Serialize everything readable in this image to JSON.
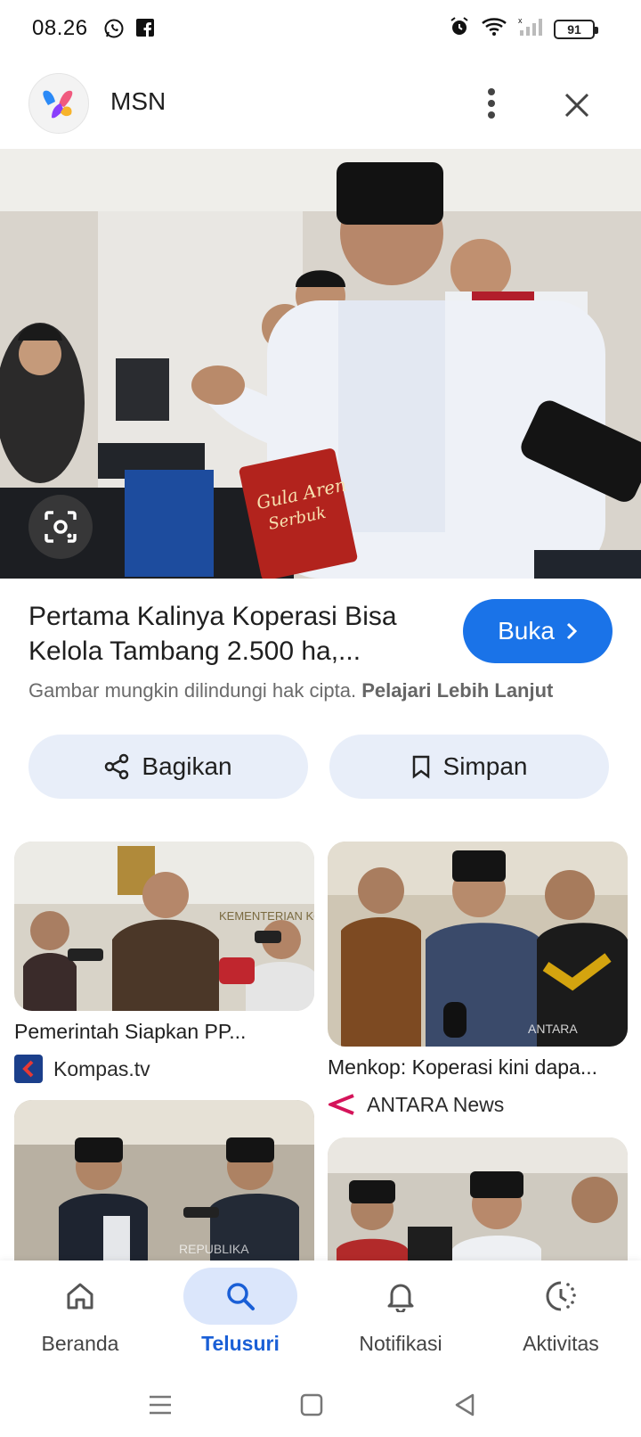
{
  "status_bar": {
    "time": "08.26",
    "battery": "91",
    "icons": [
      "whatsapp-icon",
      "facebook-icon",
      "alarm-icon",
      "wifi-icon",
      "cell-signal-icon"
    ]
  },
  "header": {
    "app_title": "MSN",
    "logo_icon": "msn-logo-icon",
    "more_icon": "more-vert-icon",
    "close_icon": "close-icon"
  },
  "hero": {
    "lens_icon": "google-lens-icon",
    "title": "Pertama Kalinya Koperasi Bisa Kelola Tambang 2.500 ha,...",
    "open_label": "Buka",
    "copyright_text": "Gambar mungkin dilindungi hak cipta.",
    "learn_more": "Pelajari Lebih Lanjut"
  },
  "actions": {
    "share_label": "Bagikan",
    "save_label": "Simpan"
  },
  "related": [
    {
      "title": "Pemerintah Siapkan PP...",
      "source": "Kompas.tv",
      "source_color": "#1b3f8b"
    },
    {
      "title": "Menkop: Koperasi kini dapa...",
      "source": "ANTARA News",
      "source_color": "#d4145a"
    },
    {
      "title": "",
      "source": ""
    },
    {
      "title": "",
      "source": ""
    }
  ],
  "bottom_nav": [
    {
      "label": "Beranda",
      "icon": "home-icon",
      "active": false
    },
    {
      "label": "Telusuri",
      "icon": "search-icon",
      "active": true
    },
    {
      "label": "Notifikasi",
      "icon": "bell-icon",
      "active": false
    },
    {
      "label": "Aktivitas",
      "icon": "activity-icon",
      "active": false
    }
  ],
  "colors": {
    "accent": "#1a73e8",
    "action_bg": "#e8eef9",
    "nav_active_bg": "#dbe6fb"
  }
}
